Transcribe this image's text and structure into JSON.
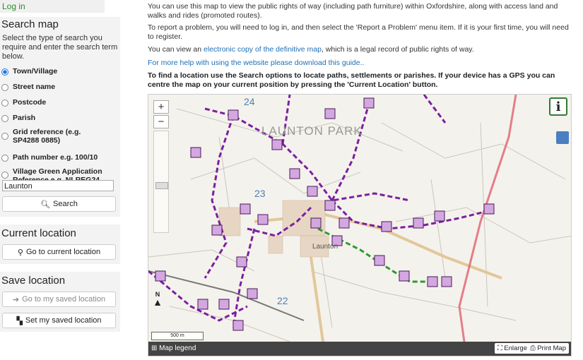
{
  "sidebar": {
    "login_label": "Log in",
    "search_map": {
      "title": "Search map",
      "description": "Select the type of search you require and enter the search term below.",
      "options": [
        {
          "label": "Town/Village",
          "checked": true
        },
        {
          "label": "Street name",
          "checked": false
        },
        {
          "label": "Postcode",
          "checked": false
        },
        {
          "label": "Parish",
          "checked": false
        },
        {
          "label": "Grid reference (e.g. SP4288 0885)",
          "checked": false
        },
        {
          "label": "Path number e.g. 100/10",
          "checked": false
        },
        {
          "label": "Village Green Application Reference e.g. NLREG24",
          "checked": false
        }
      ],
      "search_value": "Launton",
      "search_button": "Search"
    },
    "current_location": {
      "title": "Current location",
      "button": "Go to current location"
    },
    "save_location": {
      "title": "Save location",
      "goto_button": "Go to my saved location",
      "set_button": "Set my saved location"
    }
  },
  "main": {
    "p1": "You can use this map to view the public rights of way (including path furniture) within Oxfordshire, along with access land and walks and rides (promoted routes).",
    "p2": "To report a problem, you will need to log in, and then select the 'Report a Problem' menu item. If it is your first time, you will need to register.",
    "p3_pre": "You can view an ",
    "p3_link": "electronic copy of the definitive map",
    "p3_post": ", which is a legal record of public rights of way.",
    "p4_link": "For more help with using the website please download this guide..",
    "p5": "To find a location use the Search options to locate paths, settlements or parishes. If your device has a GPS you can centre the map on your current position by pressing the 'Current Location' button."
  },
  "map": {
    "zoom_in": "+",
    "zoom_out": "−",
    "info_label": "i",
    "grid_labels": [
      "24",
      "23",
      "22"
    ],
    "place_name": "LAUNTON PARK",
    "village_name": "Launton",
    "north_label": "N",
    "scale_label": "500 m",
    "legend_label": "Map legend",
    "enlarge_label": "Enlarge",
    "print_label": "Print Map",
    "colors": {
      "footpath": "#7b1fa2",
      "bridleway": "#2e9a2e",
      "boundary": "#e06070"
    }
  }
}
